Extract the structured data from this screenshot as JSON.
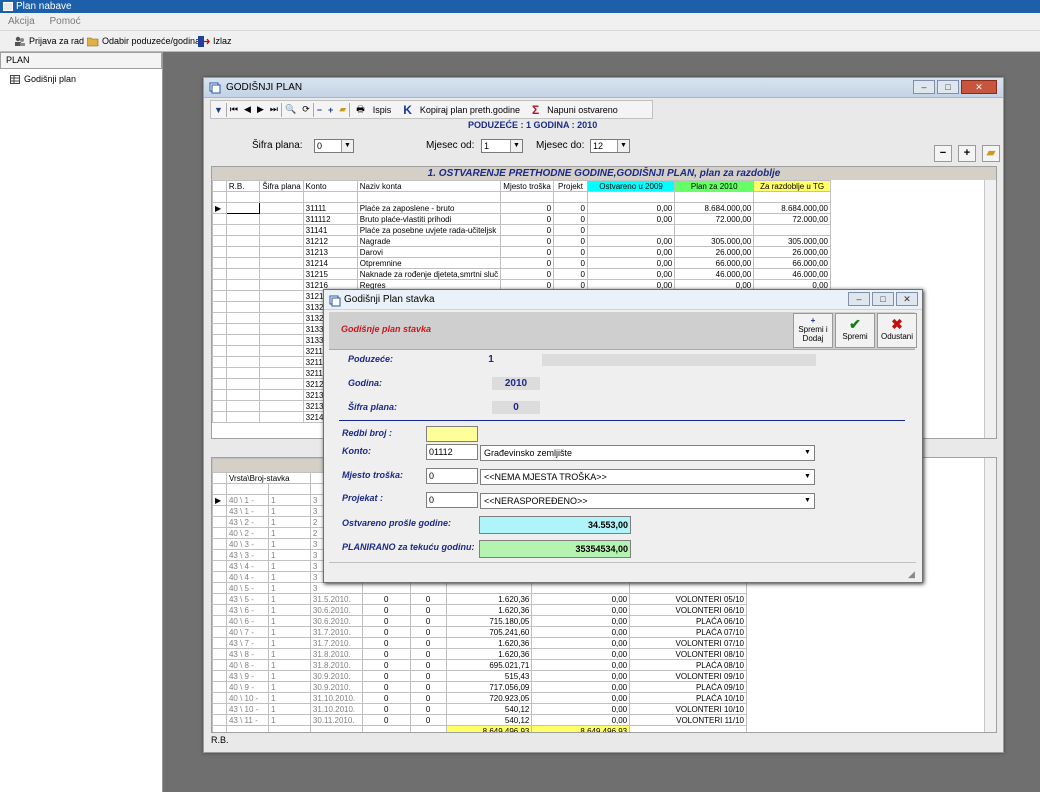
{
  "app": {
    "title": "Plan nabave"
  },
  "menu": [
    "Akcija",
    "Pomoć"
  ],
  "toolbar": {
    "login": "Prijava za rad",
    "select_company": "Odabir poduzeće/godina",
    "exit": "Izlaz"
  },
  "left_panel": {
    "header": "PLAN",
    "item": "Godišnji plan"
  },
  "window": {
    "title": "GODIŠNJI PLAN",
    "toolbar": {
      "print": "Ispis",
      "copy_plan": "Kopiraj plan preth.godine",
      "fill_actual": "Napuni ostvareno"
    },
    "company_line": "PODUZEĆE : 1 GODINA : 2010",
    "filters": {
      "plan_code_label": "Šifra plana:",
      "plan_code_value": "0",
      "month_from_label": "Mjesec od:",
      "month_from_value": "1",
      "month_to_label": "Mjesec do:",
      "month_to_value": "12"
    },
    "grid1": {
      "title": "1. OSTVARENJE PRETHODNE GODINE,GODIŠNJI PLAN, plan za razdoblje",
      "columns": [
        "R.B.",
        "Šifra plana",
        "Konto",
        "Naziv konta",
        "Mjesto troška",
        "Projekt",
        "Ostvareno u 2009",
        "Plan za 2010",
        "Za razdoblje u TG"
      ],
      "rows": [
        [
          "",
          "",
          "31111",
          "Plaće za zaposlene - bruto",
          "0",
          "0",
          "0,00",
          "8.684.000,00",
          "8.684.000,00"
        ],
        [
          "",
          "",
          "311112",
          "Bruto plaće-vlastiti prihodi",
          "0",
          "0",
          "0,00",
          "72.000,00",
          "72.000,00"
        ],
        [
          "",
          "",
          "31141",
          "Plaće za posebne uvjete rada-učiteljsk",
          "0",
          "0",
          "",
          "",
          ""
        ],
        [
          "",
          "",
          "31212",
          "Nagrade",
          "0",
          "0",
          "0,00",
          "305.000,00",
          "305.000,00"
        ],
        [
          "",
          "",
          "31213",
          "Darovi",
          "0",
          "0",
          "0,00",
          "26.000,00",
          "26.000,00"
        ],
        [
          "",
          "",
          "31214",
          "Otpremnine",
          "0",
          "0",
          "0,00",
          "66.000,00",
          "66.000,00"
        ],
        [
          "",
          "",
          "31215",
          "Naknade za rođenje djeteta,smrtni sluč",
          "0",
          "0",
          "0,00",
          "46.000,00",
          "46.000,00"
        ],
        [
          "",
          "",
          "31216",
          "Regres",
          "0",
          "0",
          "0,00",
          "0,00",
          "0,00"
        ],
        [
          "",
          "",
          "3121",
          "",
          "",
          "",
          "",
          "",
          ""
        ],
        [
          "",
          "",
          "3132",
          "",
          "",
          "",
          "",
          "",
          ""
        ],
        [
          "",
          "",
          "3132",
          "",
          "",
          "",
          "",
          "",
          ""
        ],
        [
          "",
          "",
          "3133",
          "",
          "",
          "",
          "",
          "",
          ""
        ],
        [
          "",
          "",
          "3133",
          "",
          "",
          "",
          "",
          "",
          ""
        ],
        [
          "",
          "",
          "3211",
          "",
          "",
          "",
          "",
          "",
          ""
        ],
        [
          "",
          "",
          "3211",
          "",
          "",
          "",
          "",
          "",
          ""
        ],
        [
          "",
          "",
          "3211",
          "",
          "",
          "",
          "",
          "",
          ""
        ],
        [
          "",
          "",
          "3212",
          "",
          "",
          "",
          "",
          "",
          ""
        ],
        [
          "",
          "",
          "3213",
          "",
          "",
          "",
          "",
          "",
          ""
        ],
        [
          "",
          "",
          "3213",
          "",
          "",
          "",
          "",
          "",
          ""
        ],
        [
          "",
          "",
          "3214",
          "",
          "",
          "",
          "",
          "",
          ""
        ]
      ]
    },
    "grid2": {
      "columns": [
        "Vrsta\\Broj-stavka"
      ],
      "rows": [
        [
          "40 \\ 1 -",
          "1",
          "3",
          "",
          "",
          "",
          "",
          ""
        ],
        [
          "43 \\ 1 -",
          "1",
          "3",
          "",
          "",
          "",
          "",
          ""
        ],
        [
          "43 \\ 2 -",
          "1",
          "2",
          "",
          "",
          "",
          "",
          ""
        ],
        [
          "40 \\ 2 -",
          "1",
          "2",
          "",
          "",
          "",
          "",
          ""
        ],
        [
          "40 \\ 3 -",
          "1",
          "3",
          "",
          "",
          "",
          "",
          ""
        ],
        [
          "43 \\ 3 -",
          "1",
          "3",
          "",
          "",
          "",
          "",
          ""
        ],
        [
          "43 \\ 4 -",
          "1",
          "3",
          "",
          "",
          "",
          "",
          ""
        ],
        [
          "40 \\ 4 -",
          "1",
          "3",
          "",
          "",
          "",
          "",
          ""
        ],
        [
          "40 \\ 5 -",
          "1",
          "3",
          "",
          "",
          "",
          "",
          ""
        ],
        [
          "43 \\ 5 -",
          "1",
          "31.5.2010.",
          "0",
          "0",
          "1.620,36",
          "0,00",
          "VOLONTERI 05/10"
        ],
        [
          "43 \\ 6 -",
          "1",
          "30.6.2010.",
          "0",
          "0",
          "1.620,36",
          "0,00",
          "VOLONTERI 06/10"
        ],
        [
          "40 \\ 6 -",
          "1",
          "30.6.2010.",
          "0",
          "0",
          "715.180,05",
          "0,00",
          "PLAĆA 06/10"
        ],
        [
          "40 \\ 7 -",
          "1",
          "31.7.2010.",
          "0",
          "0",
          "705.241,60",
          "0,00",
          "PLAĆA 07/10"
        ],
        [
          "43 \\ 7 -",
          "1",
          "31.7.2010.",
          "0",
          "0",
          "1.620,36",
          "0,00",
          "VOLONTERI 07/10"
        ],
        [
          "43 \\ 8 -",
          "1",
          "31.8.2010.",
          "0",
          "0",
          "1.620,36",
          "0,00",
          "VOLONTERI 08/10"
        ],
        [
          "40 \\ 8 -",
          "1",
          "31.8.2010.",
          "0",
          "0",
          "695.021,71",
          "0,00",
          "PLAĆA 08/10"
        ],
        [
          "43 \\ 9 -",
          "1",
          "30.9.2010.",
          "0",
          "0",
          "515,43",
          "0,00",
          "VOLONTERI 09/10"
        ],
        [
          "40 \\ 9 -",
          "1",
          "30.9.2010.",
          "0",
          "0",
          "717.056,09",
          "0,00",
          "PLAĆA 09/10"
        ],
        [
          "40 \\ 10 -",
          "1",
          "31.10.2010.",
          "0",
          "0",
          "720.923,05",
          "0,00",
          "PLAĆA 10/10"
        ],
        [
          "43 \\ 10 -",
          "1",
          "31.10.2010.",
          "0",
          "0",
          "540,12",
          "0,00",
          "VOLONTERI 10/10"
        ],
        [
          "43 \\ 11 -",
          "1",
          "30.11.2010.",
          "0",
          "0",
          "540,12",
          "0,00",
          "VOLONTERI 11/10"
        ]
      ],
      "totals": [
        "8.649.496,93",
        "8.649.496,93"
      ]
    },
    "status": "R.B."
  },
  "dialog": {
    "title": "Godišnji Plan stavka",
    "header": "Godišnje plan stavka",
    "buttons": {
      "save_add": "Spremi i Dodaj",
      "save": "Spremi",
      "cancel": "Odustani"
    },
    "company_label": "Poduzeće:",
    "company_value": "1",
    "year_label": "Godina:",
    "year_value": "2010",
    "plan_label": "Šifra plana:",
    "plan_value": "0",
    "ordinal_label": "Redbi broj :",
    "ordinal_value": "",
    "konto_label": "Konto:",
    "konto_code": "01112",
    "konto_name": "Građevinsko zemljište",
    "cost_label": "Mjesto troška:",
    "cost_code": "0",
    "cost_name": "<<NEMA MJESTA TROŠKA>>",
    "project_label": "Projekat :",
    "project_code": "0",
    "project_name": "<<NERASPOREĐENO>>",
    "actual_label": "Ostvareno prošle godine:",
    "actual_value": "34.553,00",
    "planned_label": "PLANIRANO za tekuću godinu:",
    "planned_value": "35354534,00"
  },
  "colors": {
    "accent_cyan": "#00ffff",
    "accent_green": "#66ff66",
    "accent_yellow": "#ffff66",
    "label_blue": "#1a2a8a",
    "header_red": "#d0161a"
  }
}
